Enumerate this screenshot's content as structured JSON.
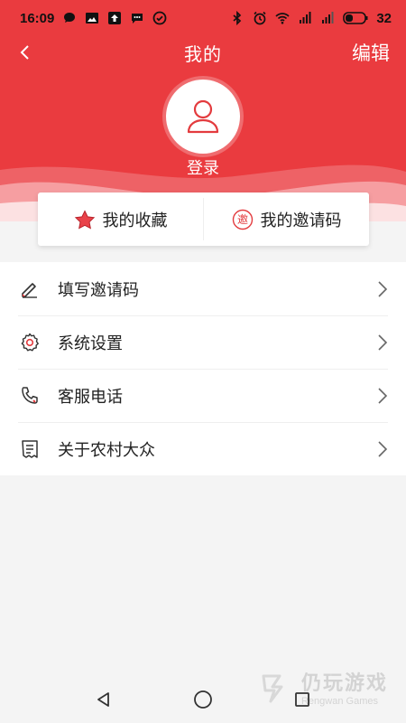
{
  "status_bar": {
    "time": "16:09",
    "battery": "32",
    "icons": [
      "chat-bubble-icon",
      "image-icon",
      "upload-icon",
      "message-icon",
      "check-circle-icon",
      "bluetooth-icon",
      "alarm-icon",
      "wifi-icon",
      "signal-icon",
      "signal-icon",
      "battery-icon"
    ]
  },
  "header": {
    "title": "我的",
    "edit_label": "编辑",
    "login_label": "登录",
    "color": "#ea3b3f"
  },
  "quick_links": [
    {
      "label": "我的收藏",
      "icon": "star-icon"
    },
    {
      "label": "我的邀请码",
      "icon": "invite-badge-icon",
      "badge_text": "邀"
    }
  ],
  "menu": [
    {
      "label": "填写邀请码",
      "icon": "pencil-icon"
    },
    {
      "label": "系统设置",
      "icon": "gear-icon"
    },
    {
      "label": "客服电话",
      "icon": "phone-icon"
    },
    {
      "label": "关于农村大众",
      "icon": "document-icon"
    }
  ],
  "watermark": {
    "cn": "仍玩游戏",
    "en": "Rengwan Games"
  }
}
